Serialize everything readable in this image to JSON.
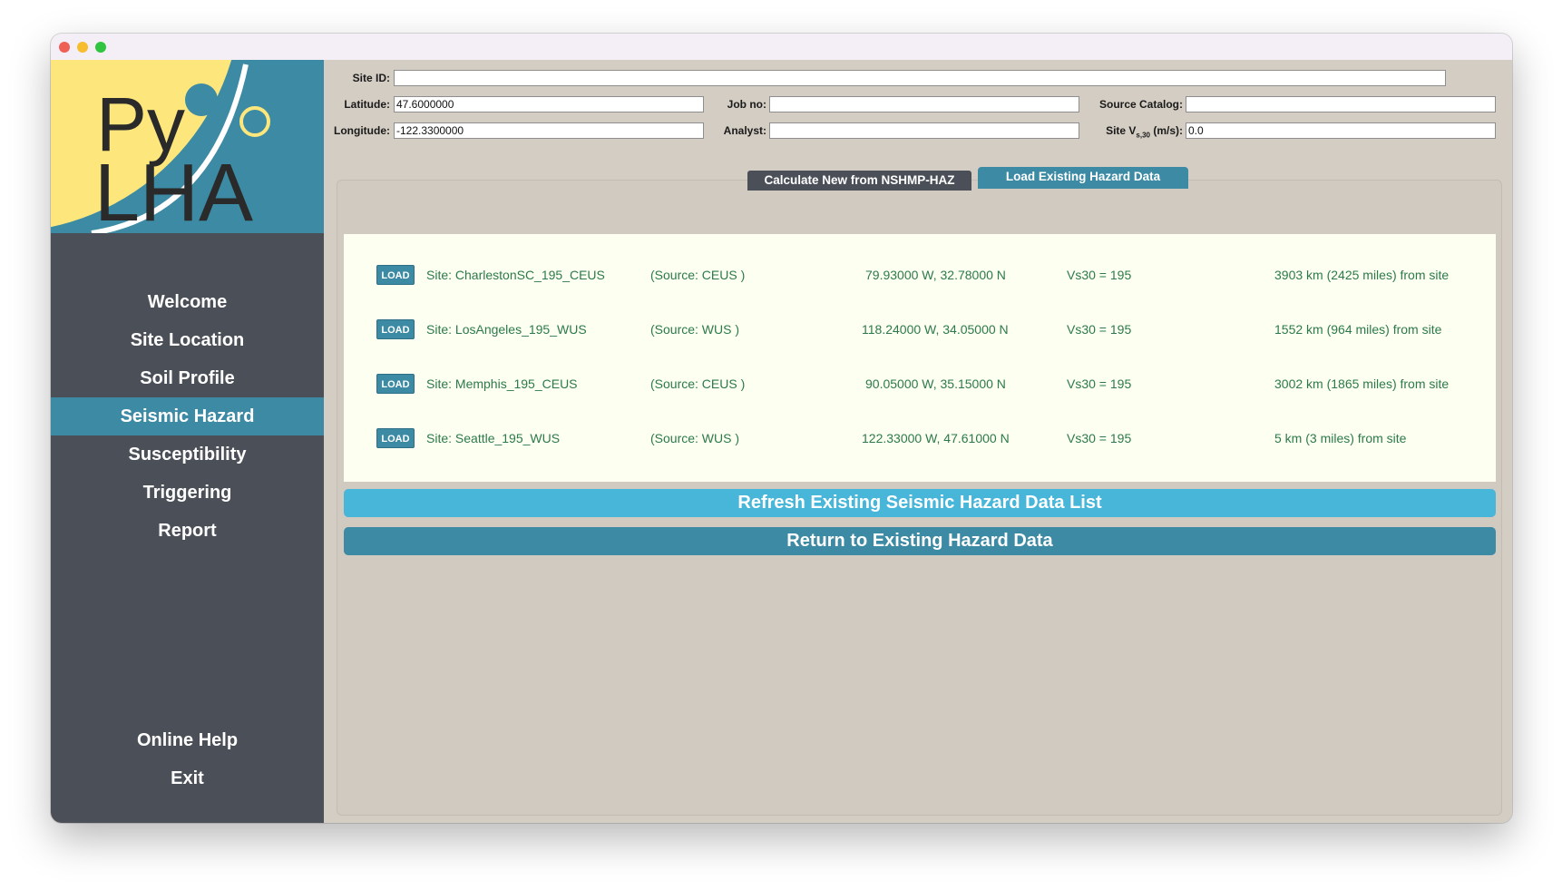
{
  "app": {
    "logo": {
      "py": "Py",
      "lha": "LHA"
    },
    "colors": {
      "accent": "#3c8aa3",
      "sidebar": "#4b4f57",
      "refresh": "#47b6d8",
      "list_text": "#2c7a4b",
      "logo_yellow": "#fde77c"
    }
  },
  "sidebar": {
    "items": [
      {
        "label": "Welcome"
      },
      {
        "label": "Site Location"
      },
      {
        "label": "Soil Profile"
      },
      {
        "label": "Seismic Hazard",
        "active": true
      },
      {
        "label": "Susceptibility"
      },
      {
        "label": "Triggering"
      },
      {
        "label": "Report"
      }
    ],
    "bottom": [
      {
        "label": "Online Help"
      },
      {
        "label": "Exit"
      }
    ]
  },
  "form": {
    "site_id": {
      "label": "Site ID:",
      "value": ""
    },
    "latitude": {
      "label": "Latitude:",
      "value": "47.6000000"
    },
    "longitude": {
      "label": "Longitude:",
      "value": "-122.3300000"
    },
    "job_no": {
      "label": "Job no:",
      "value": ""
    },
    "analyst": {
      "label": "Analyst:",
      "value": ""
    },
    "source_catalog": {
      "label": "Source Catalog:",
      "value": ""
    },
    "site_vs30": {
      "label_main": "Site V",
      "label_sub": "s,30",
      "label_unit": " (m/s):",
      "value": "0.0"
    }
  },
  "tabs": {
    "calc": "Calculate New from NSHMP-HAZ",
    "load": "Load Existing Hazard Data",
    "active": "load"
  },
  "hazard_list": [
    {
      "button": "LOAD",
      "site": "Site: CharlestonSC_195_CEUS",
      "source": "(Source: CEUS )",
      "coords": "79.93000 W, 32.78000 N",
      "vs30": "Vs30 = 195",
      "distance": "3903 km (2425 miles) from site"
    },
    {
      "button": "LOAD",
      "site": "Site: LosAngeles_195_WUS",
      "source": "(Source: WUS  )",
      "coords": "118.24000 W, 34.05000 N",
      "vs30": "Vs30 = 195",
      "distance": "1552 km (964 miles) from site"
    },
    {
      "button": "LOAD",
      "site": "Site: Memphis_195_CEUS",
      "source": "(Source: CEUS )",
      "coords": "90.05000 W, 35.15000 N",
      "vs30": "Vs30 = 195",
      "distance": "3002 km (1865 miles) from site"
    },
    {
      "button": "LOAD",
      "site": "Site: Seattle_195_WUS",
      "source": "(Source: WUS  )",
      "coords": "122.33000 W, 47.61000 N",
      "vs30": "Vs30 = 195",
      "distance": "5 km (3 miles) from site"
    }
  ],
  "buttons": {
    "refresh": "Refresh Existing Seismic Hazard Data List",
    "return": "Return to Existing Hazard Data"
  }
}
